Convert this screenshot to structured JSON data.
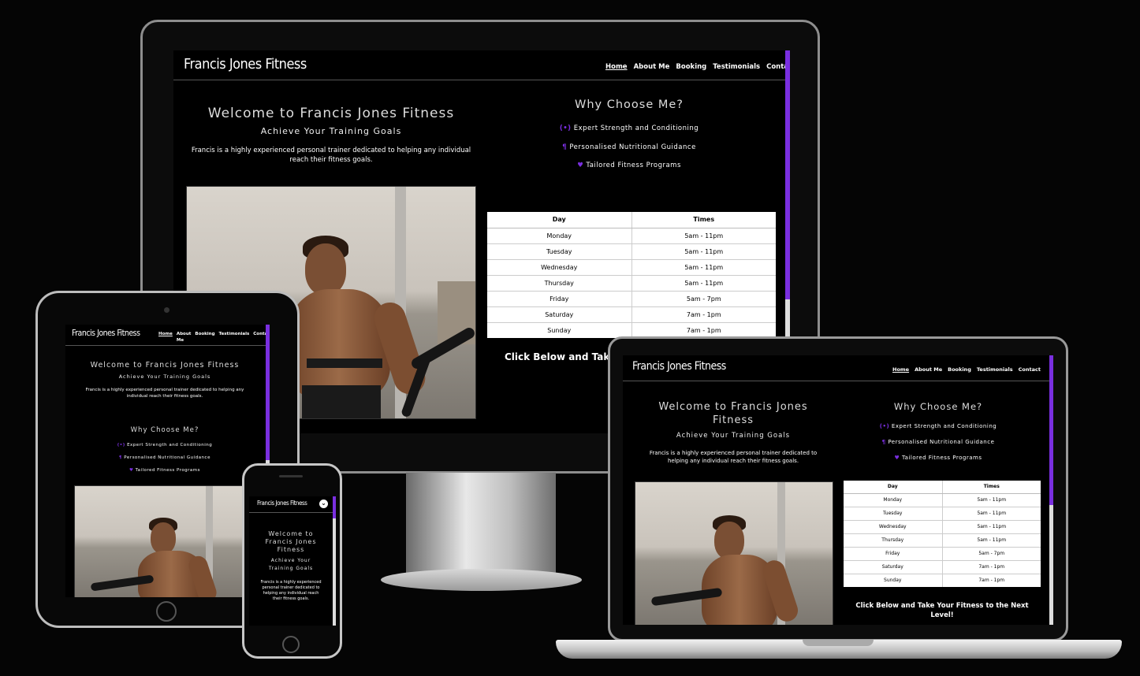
{
  "site": {
    "brand": "Francis Jones Fitness",
    "nav": [
      {
        "label": "Home",
        "active": true
      },
      {
        "label": "About Me",
        "active": false
      },
      {
        "label": "Booking",
        "active": false
      },
      {
        "label": "Testimonials",
        "active": false
      },
      {
        "label": "Contact",
        "active": false
      }
    ],
    "tablet_nav": {
      "about_line1": "About",
      "about_line2": "Me"
    },
    "welcome": "Welcome to Francis Jones Fitness",
    "welcome_laptop_line1": "Welcome to Francis Jones",
    "welcome_laptop_line2": "Fitness",
    "welcome_phone": [
      "Welcome to",
      "Francis Jones",
      "Fitness"
    ],
    "subtitle": "Achieve Your Training Goals",
    "subtitle_phone": [
      "Achieve Your",
      "Training Goals"
    ],
    "intro": "Francis is a highly experienced personal trainer dedicated to helping any individual reach their fitness goals.",
    "why_title": "Why Choose Me?",
    "features": [
      {
        "icon": "dumbbell-icon",
        "glyph": "(•)",
        "text": "Expert Strength and Conditioning"
      },
      {
        "icon": "utensils-icon",
        "glyph": "¶",
        "text": "Personalised Nutritional Guidance"
      },
      {
        "icon": "heart-icon",
        "glyph": "♥",
        "text": "Tailored Fitness Programs"
      }
    ],
    "schedule": {
      "headers": [
        "Day",
        "Times"
      ],
      "rows": [
        [
          "Monday",
          "5am - 11pm"
        ],
        [
          "Tuesday",
          "5am - 11pm"
        ],
        [
          "Wednesday",
          "5am - 11pm"
        ],
        [
          "Thursday",
          "5am - 11pm"
        ],
        [
          "Friday",
          "5am - 7pm"
        ],
        [
          "Saturday",
          "7am - 1pm"
        ],
        [
          "Sunday",
          "7am - 1pm"
        ]
      ]
    },
    "cta_monitor": "Click Below and Take",
    "cta_laptop_line1": "Click Below and Take Your Fitness to the Next",
    "cta_laptop_line2": "Level!",
    "phone_menu_glyph": "⌄"
  },
  "colors": {
    "accent": "#7a2fe0",
    "background": "#000000"
  }
}
